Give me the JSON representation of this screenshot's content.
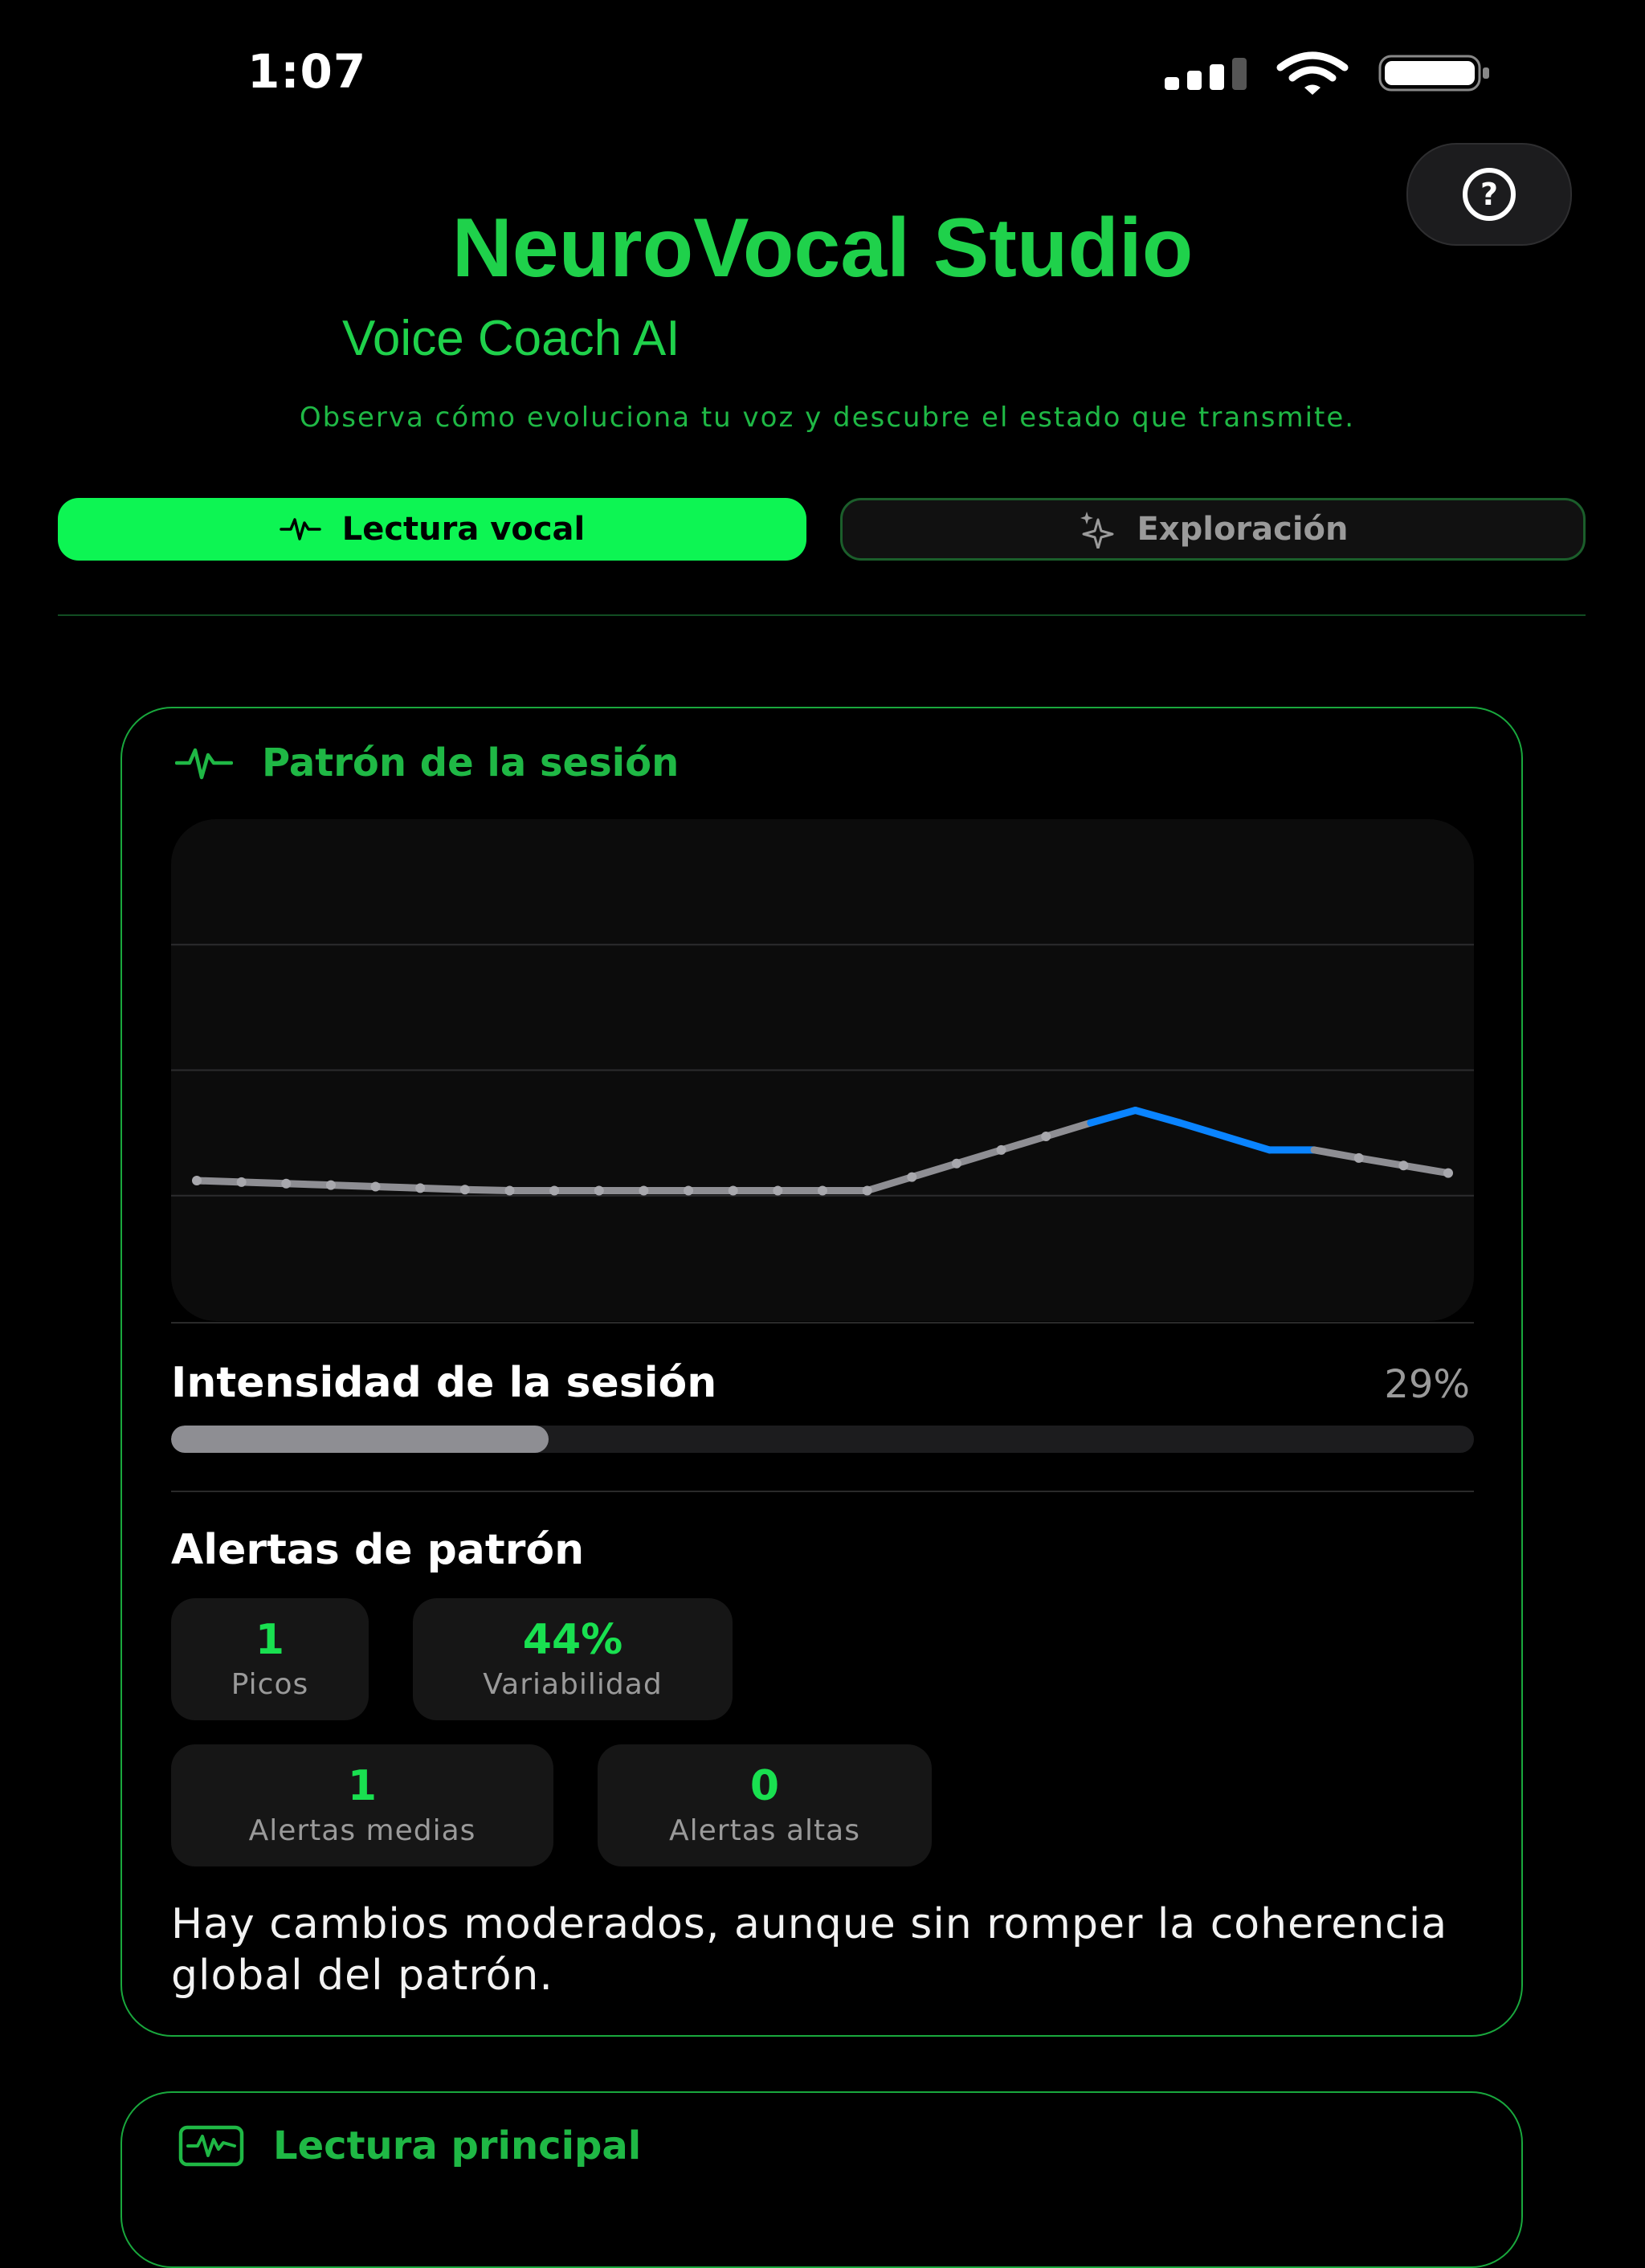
{
  "status_bar": {
    "time": "1:07"
  },
  "header": {
    "title": "NeuroVocal Studio",
    "subtitle": "Voice Coach AI",
    "tagline": "Observa cómo evoluciona tu voz y descubre el estado que transmite.",
    "help_icon": "question-circle-icon"
  },
  "tabs": [
    {
      "label": "Lectura vocal",
      "icon": "waveform-icon",
      "active": true
    },
    {
      "label": "Exploración",
      "icon": "sparkles-icon",
      "active": false
    }
  ],
  "session_card": {
    "title": "Patrón de la sesión",
    "icon": "waveform-icon",
    "intensity_label": "Intensidad de la sesión",
    "intensity_value_text": "29%",
    "intensity_fraction": 0.29,
    "alerts_label": "Alertas de patrón",
    "stats": [
      {
        "value": "1",
        "label": "Picos"
      },
      {
        "value": "44%",
        "label": "Variabilidad"
      },
      {
        "value": "1",
        "label": "Alertas medias"
      },
      {
        "value": "0",
        "label": "Alertas altas"
      }
    ],
    "summary": "Hay cambios moderados, aunque sin romper la coherencia global del patrón."
  },
  "chart_data": {
    "type": "line",
    "title": "",
    "xlabel": "",
    "ylabel": "",
    "x": [
      1,
      2,
      3,
      4,
      5,
      6,
      7,
      8,
      9,
      10,
      11,
      12,
      13,
      14,
      15,
      16,
      17,
      18,
      19,
      20,
      21,
      22,
      23,
      24,
      25,
      26,
      27,
      28,
      29
    ],
    "values": [
      0.28,
      0.277,
      0.274,
      0.271,
      0.268,
      0.265,
      0.262,
      0.26,
      0.26,
      0.26,
      0.26,
      0.26,
      0.26,
      0.26,
      0.26,
      0.26,
      0.287,
      0.314,
      0.341,
      0.368,
      0.395,
      0.42,
      0.395,
      0.368,
      0.341,
      0.341,
      0.325,
      0.31,
      0.295
    ],
    "highlight_range": [
      20,
      25
    ],
    "ylim": [
      0,
      1
    ],
    "grid": true,
    "colors": {
      "line": "#8e8e93",
      "highlight": "#0a84ff",
      "grid": "#2c2c2e"
    }
  },
  "second_card": {
    "title": "Lectura principal",
    "icon": "waveform-box-icon"
  },
  "colors": {
    "accent": "#0df553",
    "brand_green": "#1fd14b",
    "card_border": "#19a83d",
    "background": "#000000"
  }
}
